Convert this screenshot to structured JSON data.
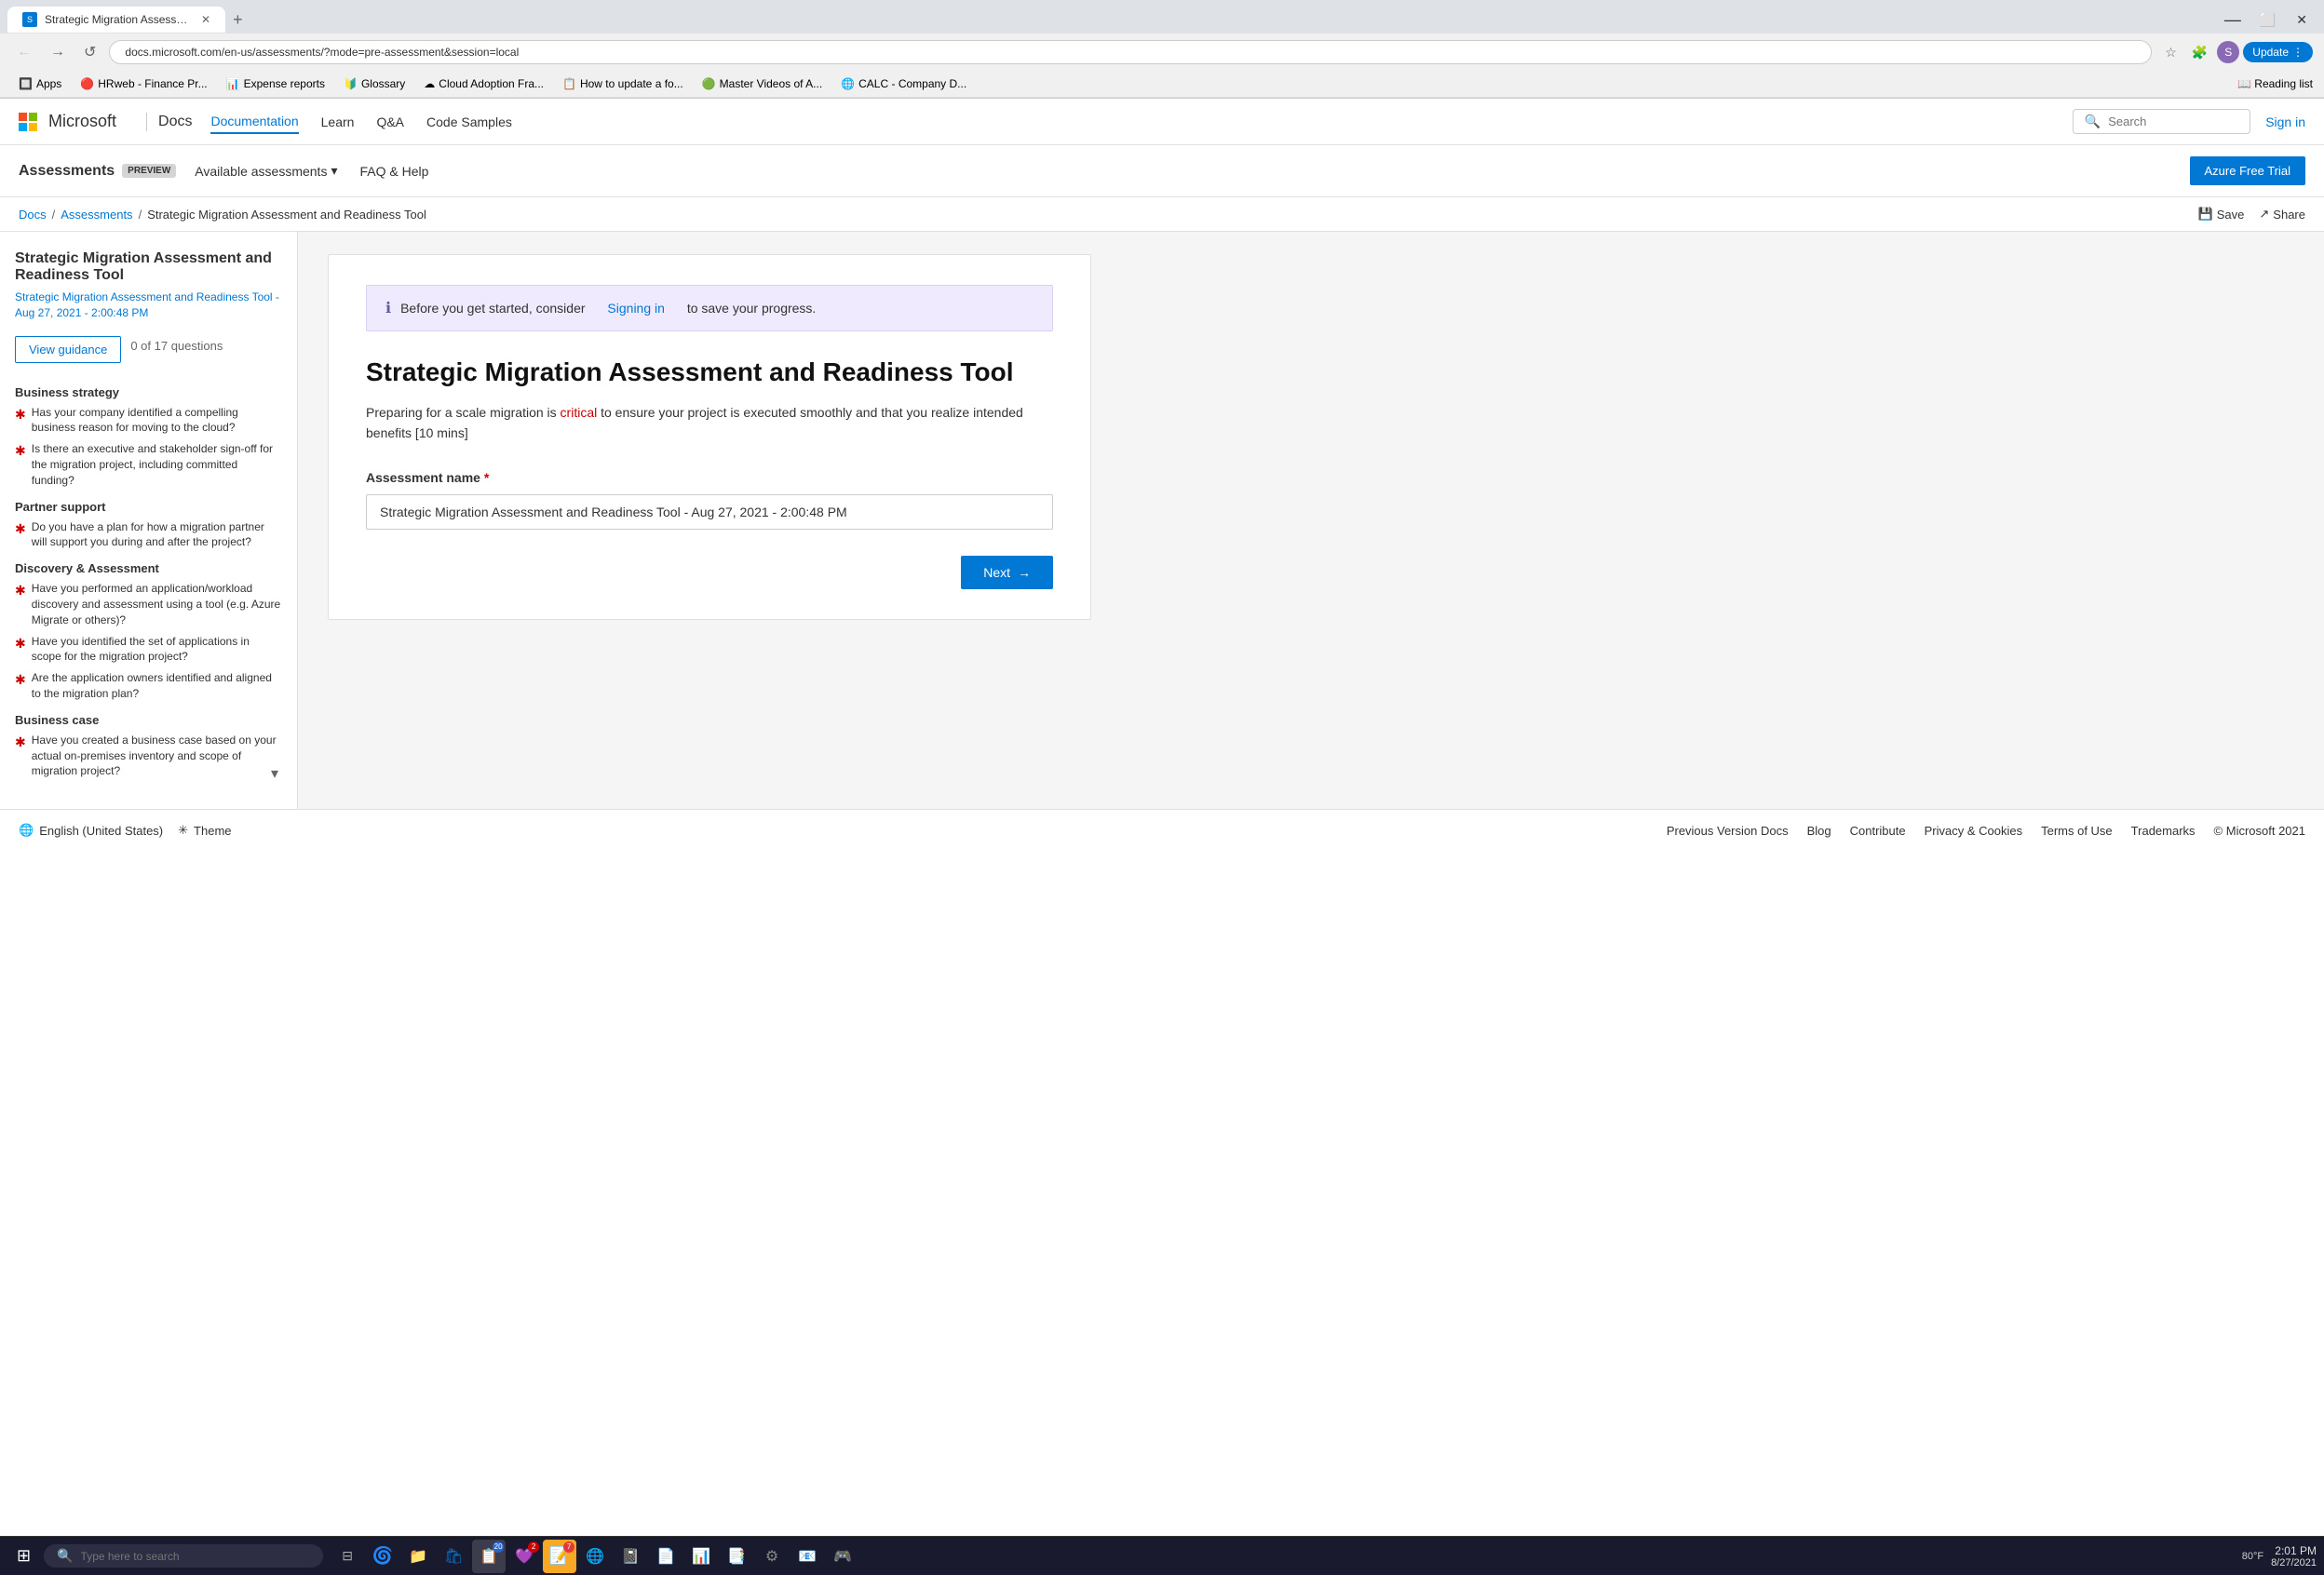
{
  "browser": {
    "tab_title": "Strategic Migration Assessment...",
    "tab_favicon": "S",
    "url": "docs.microsoft.com/en-us/assessments/?mode=pre-assessment&session=local",
    "new_tab": "+",
    "nav": {
      "back": "←",
      "forward": "→",
      "refresh": "↺"
    },
    "update_btn": "Update",
    "reading_list": "Reading list"
  },
  "bookmarks": [
    {
      "label": "Apps",
      "icon": "🔲"
    },
    {
      "label": "HRweb - Finance Pr...",
      "icon": "🔴"
    },
    {
      "label": "Expense reports",
      "icon": "📊"
    },
    {
      "label": "Glossary",
      "icon": "🔰"
    },
    {
      "label": "Cloud Adoption Fra...",
      "icon": "☁"
    },
    {
      "label": "How to update a fo...",
      "icon": "📋"
    },
    {
      "label": "Master Videos of A...",
      "icon": "🟢"
    },
    {
      "label": "CALC - Company D...",
      "icon": "🌐"
    }
  ],
  "ms_nav": {
    "brand": "Microsoft",
    "docs": "Docs",
    "nav_items": [
      "Documentation",
      "Learn",
      "Q&A",
      "Code Samples"
    ],
    "active_item": "Documentation",
    "search_placeholder": "Search",
    "sign_in": "Sign in"
  },
  "assessments_bar": {
    "title": "Assessments",
    "preview": "PREVIEW",
    "available_assessments": "Available assessments",
    "faq": "FAQ & Help",
    "azure_free": "Azure Free Trial"
  },
  "breadcrumb": {
    "docs": "Docs",
    "assessments": "Assessments",
    "current": "Strategic Migration Assessment and Readiness Tool",
    "save": "Save",
    "share": "Share"
  },
  "sidebar": {
    "title": "Strategic Migration Assessment and Readiness Tool",
    "session": "Strategic Migration Assessment and Readiness Tool - Aug 27, 2021 - 2:00:48 PM",
    "view_guidance": "View guidance",
    "question_count": "0 of 17 questions",
    "sections": [
      {
        "title": "Business strategy",
        "questions": [
          "Has your company identified a compelling business reason for moving to the cloud?",
          "Is there an executive and stakeholder sign-off for the migration project, including committed funding?"
        ]
      },
      {
        "title": "Partner support",
        "questions": [
          "Do you have a plan for how a migration partner will support you during and after the project?"
        ]
      },
      {
        "title": "Discovery & Assessment",
        "questions": [
          "Have you performed an application/workload discovery and assessment using a tool (e.g. Azure Migrate or others)?",
          "Have you identified the set of applications in scope for the migration project?",
          "Are the application owners identified and aligned to the migration plan?"
        ]
      },
      {
        "title": "Business case",
        "questions": [
          "Have you created a business case based on your actual on-premises inventory and scope of migration project?"
        ]
      }
    ]
  },
  "main": {
    "notice": {
      "icon": "ℹ",
      "text": "Before you get started, consider",
      "link": "Signing in",
      "text2": "to save your progress."
    },
    "title": "Strategic Migration Assessment and Readiness Tool",
    "description_part1": "Preparing for a scale migration is ",
    "description_critical": "critical",
    "description_part2": " to ensure your project is executed smoothly and that you realize intended benefits [10 mins]",
    "field_label": "Assessment name",
    "required_mark": "*",
    "field_value": "Strategic Migration Assessment and Readiness Tool - Aug 27, 2021 - 2:00:48 PM",
    "next_btn": "Next",
    "next_arrow": "→"
  },
  "footer": {
    "locale_icon": "🌐",
    "locale": "English (United States)",
    "theme_icon": "✳",
    "theme": "Theme",
    "links": [
      "Previous Version Docs",
      "Blog",
      "Contribute",
      "Privacy & Cookies",
      "Terms of Use",
      "Trademarks",
      "© Microsoft 2021"
    ]
  },
  "taskbar": {
    "start_icon": "⊞",
    "search_placeholder": "Type here to search",
    "search_icon": "🔍",
    "time": "2:01 PM",
    "date": "8/27/2021",
    "temp": "80°F",
    "apps": [
      "🔍",
      "🗓",
      "📁",
      "🛡",
      "🔷",
      "📋",
      "📱",
      "🌐",
      "📒",
      "📝",
      "📊",
      "📑",
      "⚙",
      "📧",
      "🎮"
    ]
  }
}
